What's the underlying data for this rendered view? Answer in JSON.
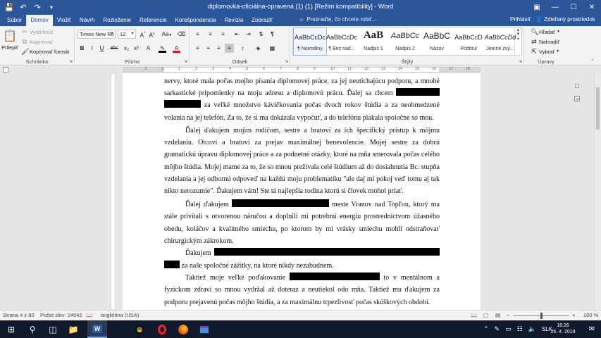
{
  "window": {
    "title": "diplomovka-oficiálna-opravená (1) (1) [Režim kompatibility] - Word",
    "title_bar_color": "#2b579a",
    "qat_icons": [
      "save-icon",
      "undo-icon",
      "redo-icon",
      "customize-icon"
    ],
    "controls": [
      "restore-ribbon-icon",
      "minimize-icon",
      "maximize-icon",
      "close-icon"
    ]
  },
  "tabs": [
    "Súbor",
    "Domov",
    "Vložiť",
    "Návrh",
    "Rozloženie",
    "Referencie",
    "Korešpondencia",
    "Revízia",
    "Zobraziť"
  ],
  "active_tab": "Domov",
  "tell_me": "Prezraďte, čo chcete robiť...",
  "signin": "Prihlásiť",
  "share": "Zdieľaný prostriedok",
  "ribbon": {
    "clipboard": {
      "label": "Schránka",
      "paste": "Prilepiť",
      "cut": "Vystrihnúť",
      "copy": "Kopírovať",
      "format_painter": "Kopírovať formát"
    },
    "font": {
      "label": "Písmo",
      "font_name": "Times New Ro",
      "font_size": "12",
      "aa_label": "Aa",
      "bold": "B",
      "italic": "I",
      "underline": "U",
      "strike": "abc",
      "subscript": "x₂",
      "superscript": "x²",
      "font_color": "#e81123",
      "highlight_color": "#000000"
    },
    "paragraph": {
      "label": "Odsek"
    },
    "styles": {
      "label": "Štýly",
      "items": [
        {
          "preview": "AaBbCcDc",
          "name": "¶ Normálny"
        },
        {
          "preview": "AaBbCcDc",
          "name": "¶ Bez riad..."
        },
        {
          "preview": "AaB",
          "name": "Nadpis 1"
        },
        {
          "preview": "AaBbCc",
          "name": "Nadpis 2"
        },
        {
          "preview": "AaBbC",
          "name": "Názov"
        },
        {
          "preview": "AaBbCcD",
          "name": "Podtitul"
        },
        {
          "preview": "AaBbCcDd",
          "name": "Jemné zvý..."
        }
      ]
    },
    "editing": {
      "label": "Úpravy",
      "find": "Hľadať",
      "replace": "Nahradiť",
      "select": "Vybrať"
    }
  },
  "ruler_numbers": [
    "2",
    "1",
    "1",
    "2",
    "3",
    "4",
    "5",
    "6",
    "7",
    "8",
    "9",
    "10",
    "11",
    "12",
    "13",
    "14",
    "15",
    "16",
    "17",
    "18"
  ],
  "document": {
    "lines": [
      {
        "parts": [
          "nervy, ktoré mala počas mojho písania diplomovej práce, za jej neutíchajúcu podporu, a mnohé"
        ]
      },
      {
        "parts": [
          "sarkastické pripomienky na moju adresu a diplomovú prácu. Ďalej sa chcem "
        ],
        "redact_end": 62
      },
      {
        "redact_start": 52,
        "parts": [
          "  za veľké množstvo kávičkovania počas dvoch rokov štúdia a za neobmedzené"
        ]
      },
      {
        "parts": [
          "volania na jej telefón. Za to, že si ma dokázala vypočuť, a do telefónu plakala spoločne so mou."
        ],
        "last": true
      },
      {
        "indent": true,
        "parts": [
          "Ďalej ďakujem mojim rodičom, sestre a bratovi za ich špecifický prístup k môjmu"
        ]
      },
      {
        "parts": [
          "vzdelaniu. Otcovi a bratovi za prejav maximálnej benevolencie. Mojej sestre za dobrú"
        ]
      },
      {
        "parts": [
          "gramatickú úpravu diplomovej práce a za podnetné otázky, ktoré na mňa smerovala počas celého"
        ]
      },
      {
        "parts": [
          "môjho štúdia. Mojej mame za to, že so mnou prežívala celé štúdium až do dosiahnutia Bc. stupňa"
        ]
      },
      {
        "parts": [
          "vzdelania a jej odbornú odpoveď na každú moju problematiku \"ale daj mi pokoj veď tomu aj tak"
        ]
      },
      {
        "parts": [
          "nikto nerozumie\". Ďakujem vám! Ste tá najlepšia rodina ktorú si človek mohol priať."
        ],
        "last": true
      },
      {
        "indent": true,
        "parts": [
          "Ďalej ďakujem ",
          " meste Vranov nad Topľou, ktorý ma"
        ],
        "redact_mid": 138
      },
      {
        "parts": [
          "stále privítali s otvorenou náručou a doplnili mi potrebnú energiu prostredníctvom úžasného"
        ]
      },
      {
        "parts": [
          "obedu, koláčov a kvalitného smiechu, po ktorom by mi vrásky smiechu mohli odstraňovať"
        ]
      },
      {
        "parts": [
          "chirurgickým zákrokom."
        ],
        "last": true
      },
      {
        "indent": true,
        "parts": [
          "Ďakujem "
        ],
        "redact_end": 320
      },
      {
        "redact_start": 22,
        "parts": [
          " za naše spoločné zážitky, na ktoré nikdy nezabudnem."
        ],
        "last": true
      },
      {
        "indent": true,
        "parts": [
          "Taktiež moje veľké poďakovanie ",
          " to v mentálnom a"
        ],
        "redact_mid": 128
      },
      {
        "parts": [
          "fyzickom zdraví so mnou vydržal až doteraz a neutiekol odo mňa. Taktiež mu ďakujem za"
        ]
      },
      {
        "parts": [
          "podporu prejavenú počas môjho štúdia, a za maximálnu trpezlivosť počas skúškových období."
        ],
        "last": true
      }
    ]
  },
  "status": {
    "page": "Strana 4 z 80",
    "words": "Počet slov: 24042",
    "language": "angličtina (USA)",
    "zoom": "100 %",
    "zoom_level": 0.5
  },
  "taskbar": {
    "apps": [
      "windows-start-icon",
      "search-icon",
      "task-view-icon",
      "file-explorer-icon",
      "word-icon",
      "chrome-icon",
      "opera-icon",
      "firefox-icon",
      "store-icon"
    ],
    "language": "SLK",
    "time": "18:26",
    "date": "25. 4. 2019"
  }
}
